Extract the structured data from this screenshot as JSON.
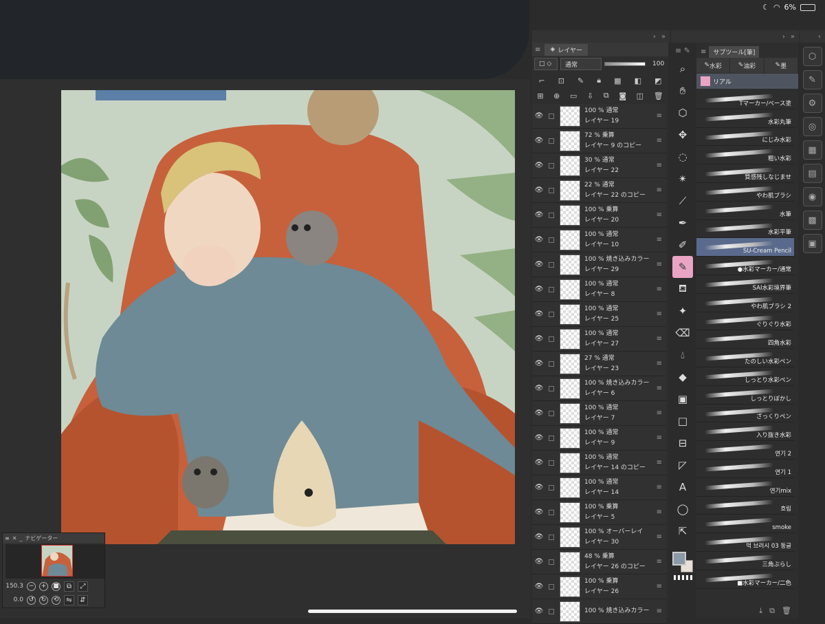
{
  "status": {
    "battery": "6%"
  },
  "layer_panel": {
    "tab_label": "レイヤー",
    "blend_mode": "通常",
    "opacity": "100",
    "layers": [
      {
        "pct": "100 %  通常",
        "name": "レイヤー 19"
      },
      {
        "pct": "72 %  乗算",
        "name": "レイヤー 9 のコピー"
      },
      {
        "pct": "30 %  通常",
        "name": "レイヤー 22"
      },
      {
        "pct": "22 %  通常",
        "name": "レイヤー 22 のコピー"
      },
      {
        "pct": "100 %  乗算",
        "name": "レイヤー 20"
      },
      {
        "pct": "100 %  通常",
        "name": "レイヤー 10"
      },
      {
        "pct": "100 %  焼き込みカラー",
        "name": "レイヤー 29"
      },
      {
        "pct": "100 %  通常",
        "name": "レイヤー 8"
      },
      {
        "pct": "100 %  通常",
        "name": "レイヤー 25"
      },
      {
        "pct": "100 %  通常",
        "name": "レイヤー 27"
      },
      {
        "pct": "27 %  通常",
        "name": "レイヤー 23"
      },
      {
        "pct": "100 %  焼き込みカラー",
        "name": "レイヤー 6"
      },
      {
        "pct": "100 %  通常",
        "name": "レイヤー 7"
      },
      {
        "pct": "100 %  通常",
        "name": "レイヤー 9"
      },
      {
        "pct": "100 %  通常",
        "name": "レイヤー 14 のコピー"
      },
      {
        "pct": "100 %  通常",
        "name": "レイヤー 14"
      },
      {
        "pct": "100 %  乗算",
        "name": "レイヤー 5"
      },
      {
        "pct": "100 %  オーバーレイ",
        "name": "レイヤー 30"
      },
      {
        "pct": "48 %  乗算",
        "name": "レイヤー 26 のコピー"
      },
      {
        "pct": "100 %  乗算",
        "name": "レイヤー 26"
      },
      {
        "pct": "100 %  焼き込みカラー",
        "name": ""
      }
    ]
  },
  "subtool_panel": {
    "tab_label": "サブツール[筆]",
    "categories": [
      "水彩",
      "油彩",
      "墨"
    ],
    "selected": "リアル",
    "brushes": [
      "Tマーカー/ベース塗",
      "水彩丸筆",
      "にじみ水彩",
      "粗い水彩",
      "質感残しなじませ",
      "やわ肌ブラシ",
      "水筆",
      "水彩平筆",
      "SU-Cream Pencil",
      "●水彩マーカー/通常",
      "SAI水彩境界筆",
      "やわ肌ブラシ 2",
      "ぐりぐり水彩",
      "四角水彩",
      "たのしい水彩ペン",
      "しっとり水彩ペン",
      "しっとりぼかし",
      "ざっくりペン",
      "入り抜き水彩",
      "연기 2",
      "연기 1",
      "연기mix",
      "흐림",
      "smoke",
      "먹 브러시 03 둥글",
      "三角ぶらし",
      "■水彩マーカー/二色"
    ]
  },
  "navigator": {
    "title": "ナビゲーター",
    "zoom": "150.3",
    "rotation": "0.0"
  },
  "colors": {
    "main": "#8b9aa8",
    "sub": "#e8e0d6",
    "accent": "#e9a4c4"
  }
}
